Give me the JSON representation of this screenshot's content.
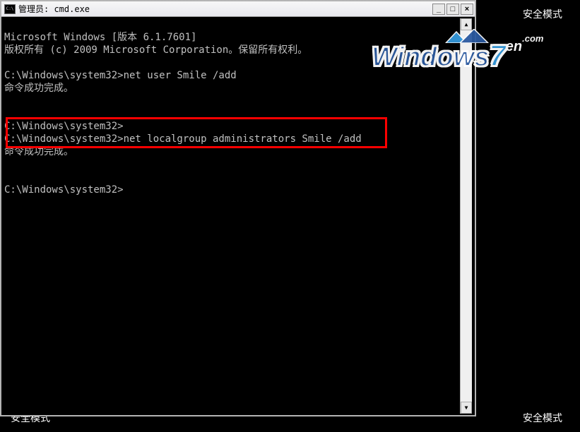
{
  "desktop": {
    "safe_mode_top": "安全模式",
    "safe_mode_bottom": "安全模式",
    "safe_mode_bottom_left": "安全模式"
  },
  "window": {
    "title": "管理员: cmd.exe",
    "controls": {
      "minimize": "_",
      "maximize": "□",
      "close": "×"
    }
  },
  "terminal": {
    "lines": [
      "Microsoft Windows [版本 6.1.7601]",
      "版权所有 (c) 2009 Microsoft Corporation。保留所有权利。",
      "",
      "C:\\Windows\\system32>net user Smile /add",
      "命令成功完成。",
      "",
      "",
      "C:\\Windows\\system32>",
      "C:\\Windows\\system32>net localgroup administrators Smile /add",
      "命令成功完成。",
      "",
      "",
      "C:\\Windows\\system32>"
    ]
  },
  "watermark": {
    "text_windows": "Windows",
    "text_seven": "7",
    "text_en": "en",
    "text_com": ".com"
  }
}
